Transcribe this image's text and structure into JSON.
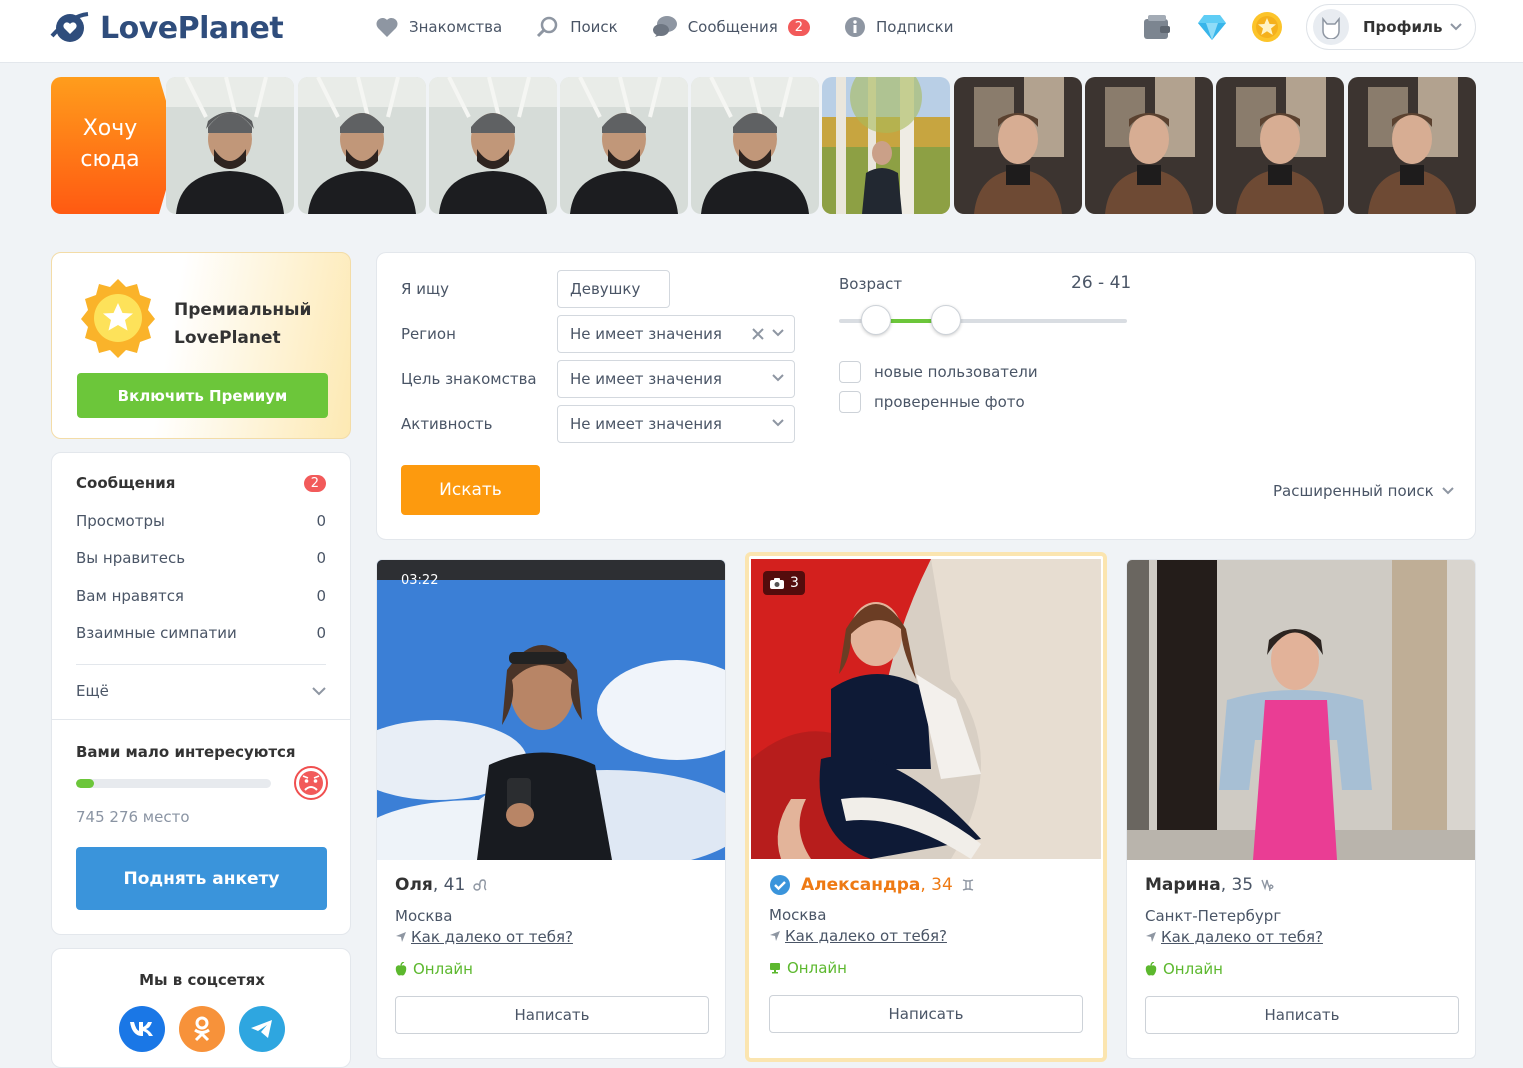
{
  "header": {
    "logo_text": "LovePlanet",
    "nav": [
      {
        "label": "Знакомства"
      },
      {
        "label": "Поиск"
      },
      {
        "label": "Сообщения",
        "badge": "2"
      },
      {
        "label": "Подписки"
      }
    ],
    "profile_label": "Профиль"
  },
  "strip": {
    "want_here": "Хочу сюда"
  },
  "premium": {
    "title_line1": "Премиальный",
    "title_line2": "LovePlanet",
    "button": "Включить Премиум"
  },
  "stats": {
    "items": [
      {
        "label": "Сообщения",
        "value": "2"
      },
      {
        "label": "Просмотры",
        "value": "0"
      },
      {
        "label": "Вы нравитесь",
        "value": "0"
      },
      {
        "label": "Вам нравятся",
        "value": "0"
      },
      {
        "label": "Взаимные симпатии",
        "value": "0"
      }
    ],
    "more": "Ещё",
    "low_interest": "Вами мало интересуются",
    "progress_percent": 9,
    "place": "745 276 место",
    "raise_button": "Поднять анкету"
  },
  "social": {
    "title": "Мы в соцсетях"
  },
  "search": {
    "seek_label": "Я ищу",
    "seek_value": "Девушку",
    "region_label": "Регион",
    "region_value": "Не имеет значения",
    "goal_label": "Цель знакомства",
    "goal_value": "Не имеет значения",
    "activity_label": "Активность",
    "activity_value": "Не имеет значения",
    "age_label": "Возраст",
    "age_value": "26 - 41",
    "age_min": 26,
    "age_max": 41,
    "new_users": "новые пользователи",
    "verified_photo": "проверенные фото",
    "search_button": "Искать",
    "advanced": "Расширенный поиск"
  },
  "profiles": [
    {
      "name": "Оля",
      "age": ", 41",
      "city": "Москва",
      "distance": "Как далеко от тебя?",
      "online": "Онлайн",
      "write": "Написать",
      "status_time": "03:22"
    },
    {
      "name": "Александра",
      "age": ", 34",
      "city": "Москва",
      "distance": "Как далеко от тебя?",
      "online": "Онлайн",
      "write": "Написать",
      "photo_count": "3"
    },
    {
      "name": "Марина",
      "age": ", 35",
      "city": "Санкт-Петербург",
      "distance": "Как далеко от тебя?",
      "online": "Онлайн",
      "write": "Написать"
    }
  ],
  "colors": {
    "accent_green": "#6cc63a",
    "accent_orange": "#fd9a0e",
    "accent_blue": "#3a94db",
    "badge_red": "#f25a5a"
  }
}
